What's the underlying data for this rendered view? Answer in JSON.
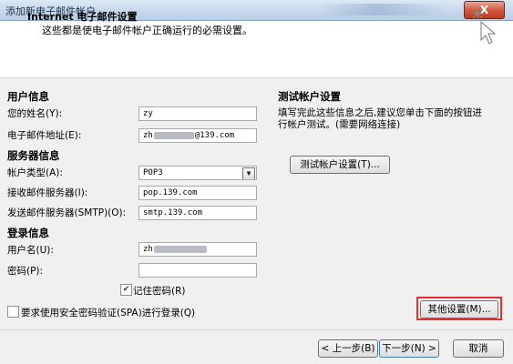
{
  "window": {
    "title": "添加新电子邮件帐户",
    "close_label": "X"
  },
  "header": {
    "title": "Internet 电子邮件设置",
    "subtitle": "这些都是使电子邮件帐户正确运行的必需设置。",
    "icon": "mouse-pointer-sparkle-icon"
  },
  "user_info": {
    "heading": "用户信息",
    "name_label": "您的姓名(Y):",
    "name_value": "zy",
    "email_label": "电子邮件地址(E):",
    "email_prefix": "zh",
    "email_suffix": "@139.com"
  },
  "server_info": {
    "heading": "服务器信息",
    "account_type_label": "帐户类型(A):",
    "account_type_value": "POP3",
    "incoming_label": "接收邮件服务器(I):",
    "incoming_value": "pop.139.com",
    "outgoing_label": "发送邮件服务器(SMTP)(O):",
    "outgoing_value": "smtp.139.com"
  },
  "login_info": {
    "heading": "登录信息",
    "username_label": "用户名(U):",
    "username_prefix": "zh",
    "password_label": "密码(P):",
    "remember_label": "记住密码(R)",
    "remember_checked": true,
    "spa_label": "要求使用安全密码验证(SPA)进行登录(Q)",
    "spa_checked": false
  },
  "test_settings": {
    "heading": "测试帐户设置",
    "description_line1": "填写完此这些信息之后,建议您单击下面的按钮进",
    "description_line2": "行帐户测试。(需要网络连接)",
    "test_button": "测试帐户设置(T)..."
  },
  "more_settings_button": "其他设置(M)...",
  "footer": {
    "back_button": "< 上一步(B)",
    "next_button": "下一步(N) >",
    "cancel_button": "取消"
  },
  "colors": {
    "highlight": "#e03030",
    "title_gradient": "#c6d8ec"
  }
}
